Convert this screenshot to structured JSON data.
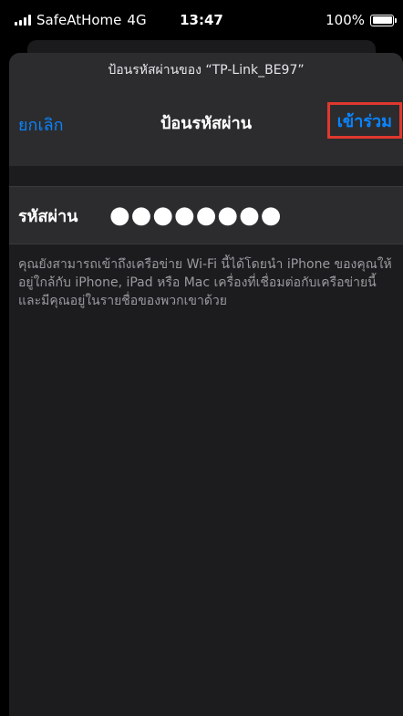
{
  "status_bar": {
    "carrier": "SafeAtHome",
    "network": "4G",
    "time": "13:47",
    "battery": "100%"
  },
  "sheet": {
    "subtitle": "ป้อนรหัสผ่านของ “TP-Link_BE97”",
    "cancel_label": "ยกเลิก",
    "title": "ป้อนรหัสผ่าน",
    "join_label": "เข้าร่วม",
    "password_label": "รหัสผ่าน",
    "password_value": "●●●●●●●●",
    "info_text": "คุณยังสามารถเข้าถึงเครือข่าย Wi-Fi นี้ได้โดยนำ iPhone ของคุณให้อยู่ใกล้กับ iPhone, iPad หรือ Mac เครื่องที่เชื่อมต่อกับเครือข่ายนี้และมีคุณอยู่ในรายชื่อของพวกเขาด้วย"
  },
  "colors": {
    "accent": "#0a84ff",
    "highlight_border": "#e0382f"
  }
}
